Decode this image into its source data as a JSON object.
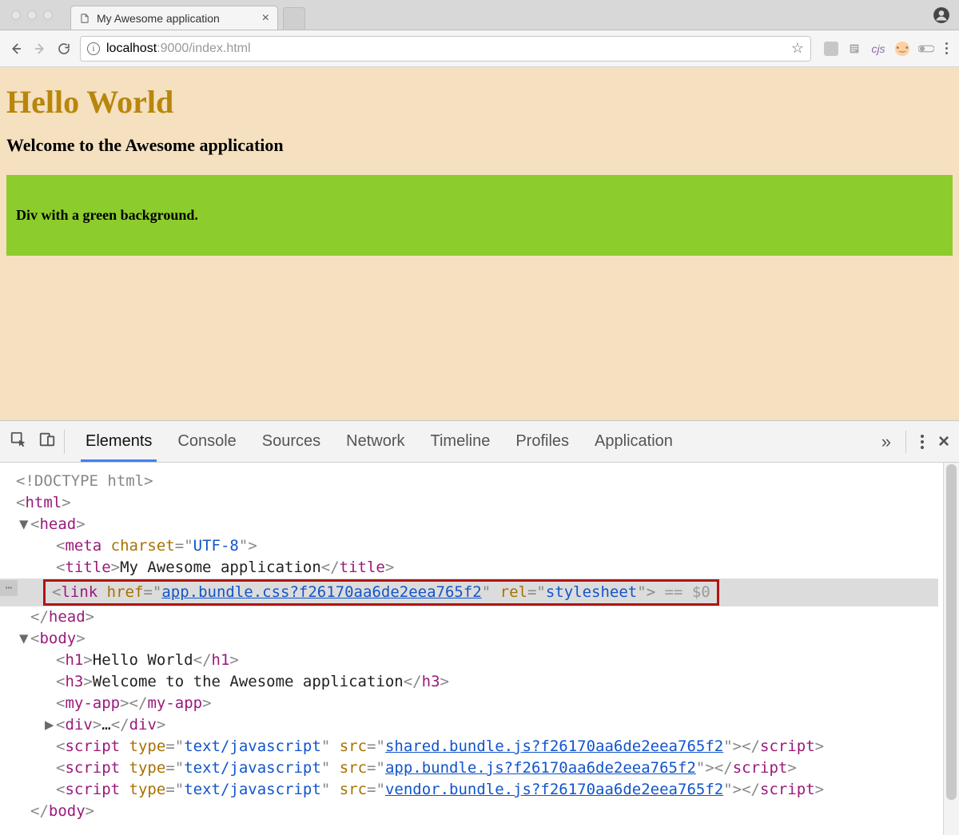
{
  "browser": {
    "tab_title": "My Awesome application",
    "url_prefix": "localhost",
    "url_rest": ":9000/index.html"
  },
  "toolbar_ext": {
    "cjs": "cjs"
  },
  "page": {
    "h1": "Hello World",
    "h3": "Welcome to the Awesome application",
    "green_text": "Div with a green background."
  },
  "devtools": {
    "tabs": [
      "Elements",
      "Console",
      "Sources",
      "Network",
      "Timeline",
      "Profiles",
      "Application"
    ],
    "overflow": "»",
    "dom": {
      "doctype": "<!DOCTYPE html>",
      "html_open": "html",
      "head_open": "head",
      "meta_attr_name": "charset",
      "meta_attr_val": "UTF-8",
      "title_tag": "title",
      "title_text": "My Awesome application",
      "link_tag": "link",
      "link_href_name": "href",
      "link_href_val": "app.bundle.css?f26170aa6de2eea765f2",
      "link_rel_name": "rel",
      "link_rel_val": "stylesheet",
      "selected_suffix": " == $0",
      "head_close": "head",
      "body_open": "body",
      "h1_text": "Hello World",
      "h3_text": "Welcome to the Awesome application",
      "myapp_tag": "my-app",
      "div_tag": "div",
      "div_ellipsis": "…",
      "script_tag": "script",
      "script_type_name": "type",
      "script_type_val": "text/javascript",
      "script_src_name": "src",
      "script1_src": "shared.bundle.js?f26170aa6de2eea765f2",
      "script2_src": "app.bundle.js?f26170aa6de2eea765f2",
      "script3_src": "vendor.bundle.js?f26170aa6de2eea765f2",
      "body_close": "body"
    }
  }
}
